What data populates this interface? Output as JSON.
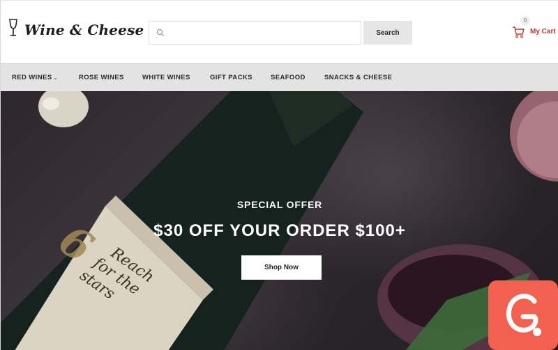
{
  "brand": {
    "name": "Wine & Cheese",
    "logo_icon": "wine-glass-icon"
  },
  "search": {
    "placeholder": "",
    "value": "",
    "button_label": "Search",
    "icon": "search-icon"
  },
  "cart": {
    "count": "0",
    "label": "My Cart",
    "icon": "cart-icon"
  },
  "nav": {
    "items": [
      {
        "label": "RED WINES",
        "has_dropdown": true
      },
      {
        "label": "ROSE WINES"
      },
      {
        "label": "WHITE WINES"
      },
      {
        "label": "GIFT PACKS"
      },
      {
        "label": "SEAFOOD"
      },
      {
        "label": "SNACKS & CHEESE"
      }
    ]
  },
  "hero": {
    "subtitle": "SPECIAL OFFER",
    "title": "$30 OFF YOUR ORDER $100+",
    "button_label": "Shop Now",
    "label_text": [
      "6",
      "Reach",
      "for the",
      "stars"
    ]
  },
  "colors": {
    "accent": "#c0392b",
    "nav_bg": "#e3e3e3",
    "badge": "#f2604f"
  }
}
